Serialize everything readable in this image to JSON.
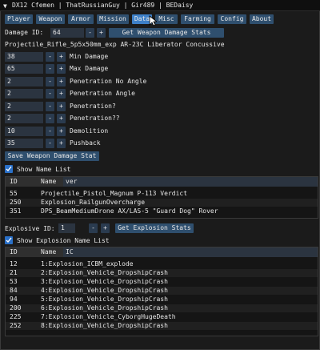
{
  "title": "DX12 Cfemen | ThatRussianGuy | Gir489 | BEDaisy",
  "tabs": [
    "Player",
    "Weapon",
    "Armor",
    "Mission",
    "Data",
    "Misc",
    "Farming",
    "Config",
    "About"
  ],
  "active_tab": "Data",
  "damage": {
    "id_label": "Damage ID:",
    "id_value": "64",
    "minus": "-",
    "plus": "+",
    "get_button": "Get Weapon Damage Stats",
    "weapon_name": "Projectile_Rifle_5p5x50mm_exp AR-23C Liberator Concussive",
    "stats": [
      {
        "value": "38",
        "label": "Min Damage"
      },
      {
        "value": "65",
        "label": "Max Damage"
      },
      {
        "value": "2",
        "label": "Penetration No Angle"
      },
      {
        "value": "2",
        "label": "Penetration Angle"
      },
      {
        "value": "2",
        "label": "Penetration?"
      },
      {
        "value": "2",
        "label": "Penetration??"
      },
      {
        "value": "10",
        "label": "Demolition"
      },
      {
        "value": "35",
        "label": "Pushback"
      }
    ],
    "save_button": "Save Weapon Damage Stat",
    "show_name_list": "Show Name List",
    "table": {
      "col_id": "ID",
      "col_name": "Name",
      "filter": "ver",
      "rows": [
        {
          "id": "55",
          "name": "Projectile_Pistol_Magnum P-113 Verdict"
        },
        {
          "id": "250",
          "name": "Explosion_RailgunOvercharge"
        },
        {
          "id": "351",
          "name": "DPS_BeamMediumDrone AX/LAS-5 \"Guard Dog\" Rover"
        }
      ]
    }
  },
  "explosive": {
    "id_label": "Explosive ID:",
    "id_value": "1",
    "minus": "-",
    "plus": "+",
    "get_button": "Get Explosion Stats",
    "show_name_list": "Show Explosion Name List",
    "table": {
      "col_id": "ID",
      "col_name": "Name",
      "filter": "IC",
      "rows": [
        {
          "id": "12",
          "name": "1:Explosion_ICBM_explode"
        },
        {
          "id": "21",
          "name": "2:Explosion_Vehicle_DropshipCrash"
        },
        {
          "id": "53",
          "name": "3:Explosion_Vehicle_DropshipCrash"
        },
        {
          "id": "84",
          "name": "4:Explosion_Vehicle_DropshipCrash"
        },
        {
          "id": "94",
          "name": "5:Explosion_Vehicle_DropshipCrash"
        },
        {
          "id": "200",
          "name": "6:Explosion_Vehicle_DropshipCrash"
        },
        {
          "id": "225",
          "name": "7:Explosion_Vehicle_CyborgHugeDeath"
        },
        {
          "id": "252",
          "name": "8:Explosion_Vehicle_DropshipCrash"
        }
      ]
    }
  },
  "colors": {
    "accent": "#3e80c8",
    "button": "#2f4f6e",
    "input": "#2b3440"
  }
}
